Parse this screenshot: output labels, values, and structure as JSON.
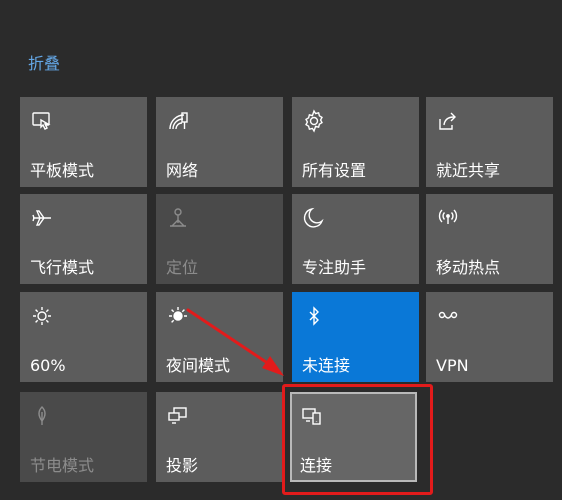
{
  "header": {
    "collapse_label": "折叠"
  },
  "tiles": [
    {
      "label": "平板模式",
      "icon": "tablet-mode-icon",
      "state": "normal"
    },
    {
      "label": "网络",
      "icon": "network-icon",
      "state": "normal"
    },
    {
      "label": "所有设置",
      "icon": "gear-icon",
      "state": "normal"
    },
    {
      "label": "就近共享",
      "icon": "nearby-share-icon",
      "state": "normal"
    },
    {
      "label": "飞行模式",
      "icon": "airplane-icon",
      "state": "normal"
    },
    {
      "label": "定位",
      "icon": "location-icon",
      "state": "disabled"
    },
    {
      "label": "专注助手",
      "icon": "moon-icon",
      "state": "normal"
    },
    {
      "label": "移动热点",
      "icon": "hotspot-icon",
      "state": "normal"
    },
    {
      "label": "60%",
      "icon": "brightness-icon",
      "state": "normal"
    },
    {
      "label": "夜间模式",
      "icon": "night-light-icon",
      "state": "normal"
    },
    {
      "label": "未连接",
      "icon": "bluetooth-icon",
      "state": "active"
    },
    {
      "label": "VPN",
      "icon": "vpn-icon",
      "state": "normal"
    },
    {
      "label": "节电模式",
      "icon": "battery-saver-icon",
      "state": "disabled"
    },
    {
      "label": "投影",
      "icon": "project-icon",
      "state": "normal"
    },
    {
      "label": "连接",
      "icon": "connect-icon",
      "state": "selected"
    }
  ],
  "colors": {
    "background": "#2b2b2b",
    "tile": "#5c5c5c",
    "tile_active": "#0a78d7",
    "tile_disabled": "#4a4a4a",
    "accent_link": "#64a7e6",
    "annotation_red": "#e21b1b"
  }
}
